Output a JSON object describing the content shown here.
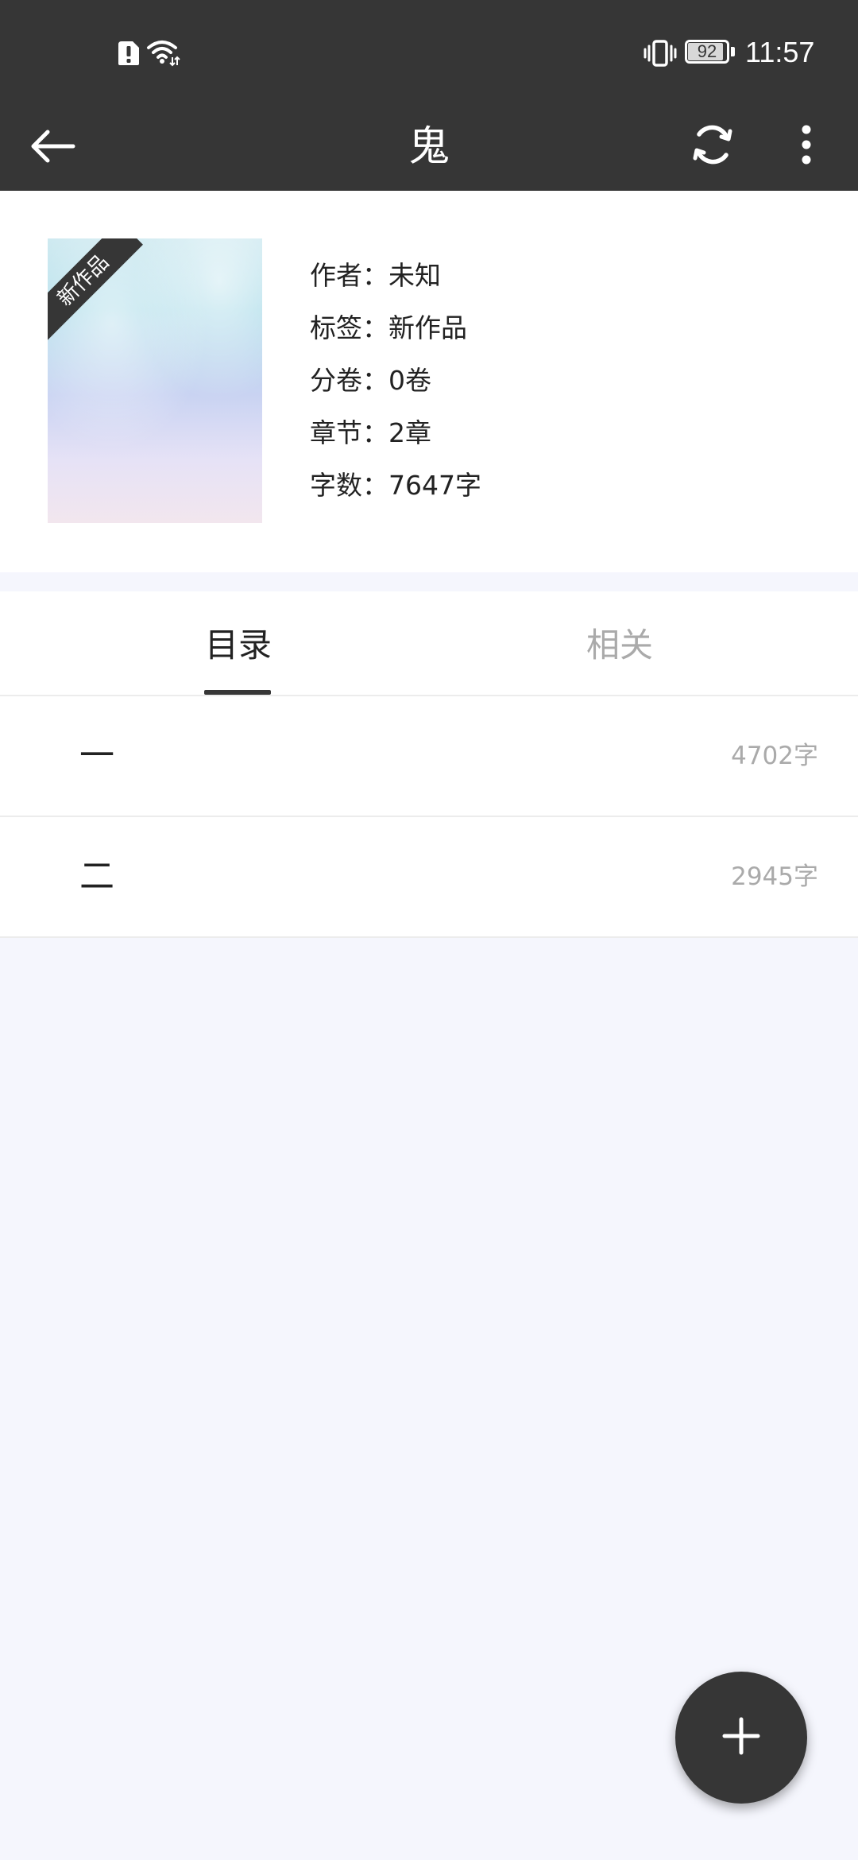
{
  "status_bar": {
    "time": "11:57",
    "battery_level": "92",
    "battery_fraction": 0.92,
    "icons": [
      "alert-icon",
      "wifi-icon",
      "vibrate-icon",
      "battery-icon"
    ]
  },
  "toolbar": {
    "title": "鬼",
    "icons": [
      "back-arrow-icon",
      "sync-icon",
      "more-vert-icon"
    ]
  },
  "book": {
    "cover_ribbon": "新作品",
    "meta": [
      "作者：未知",
      "标签：新作品",
      "分卷：0卷",
      "章节：2章",
      "字数：7647字"
    ]
  },
  "tabs": [
    {
      "label": "目录",
      "active": true
    },
    {
      "label": "相关",
      "active": false
    }
  ],
  "chapters": [
    {
      "title": "一",
      "words": "4702字"
    },
    {
      "title": "二",
      "words": "2945字"
    }
  ],
  "fab": {
    "icon": "plus-icon"
  },
  "colors": {
    "toolbar_bg": "#363636",
    "page_bg": "#f5f6fd",
    "card_bg": "#ffffff",
    "muted_text": "#aaaaaa"
  }
}
